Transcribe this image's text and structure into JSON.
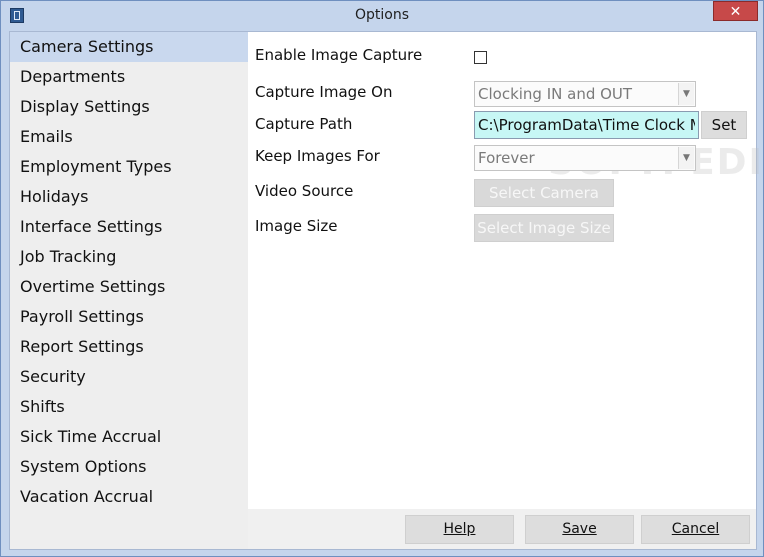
{
  "window": {
    "title": "Options",
    "close_glyph": "✕",
    "app_icon": "time-clock-icon"
  },
  "sidebar": {
    "items": [
      {
        "label": "Camera Settings",
        "selected": true
      },
      {
        "label": "Departments"
      },
      {
        "label": "Display Settings"
      },
      {
        "label": "Emails"
      },
      {
        "label": "Employment Types"
      },
      {
        "label": "Holidays"
      },
      {
        "label": "Interface Settings"
      },
      {
        "label": "Job Tracking"
      },
      {
        "label": "Overtime Settings"
      },
      {
        "label": "Payroll Settings"
      },
      {
        "label": "Report Settings"
      },
      {
        "label": "Security"
      },
      {
        "label": "Shifts"
      },
      {
        "label": "Sick Time Accrual"
      },
      {
        "label": "System Options"
      },
      {
        "label": "Vacation Accrual"
      }
    ]
  },
  "camera": {
    "enable_label": "Enable Image Capture",
    "enable_checked": false,
    "capture_on_label": "Capture Image On",
    "capture_on_value": "Clocking IN and OUT",
    "path_label": "Capture Path",
    "path_value": "C:\\ProgramData\\Time Clock MT",
    "set_label": "Set",
    "keep_label": "Keep Images For",
    "keep_value": "Forever",
    "video_label": "Video Source",
    "select_camera_label": "Select Camera",
    "size_label": "Image Size",
    "select_size_label": "Select Image Size"
  },
  "watermark": "SOFTPEDIA",
  "footer": {
    "help_label": "Help",
    "save_label": "Save",
    "cancel_label": "Cancel"
  },
  "colors": {
    "frame": "#c5d5ec",
    "selected_item": "#c9d8ee",
    "path_field": "#c7f7f5",
    "close_button": "#c74949"
  }
}
